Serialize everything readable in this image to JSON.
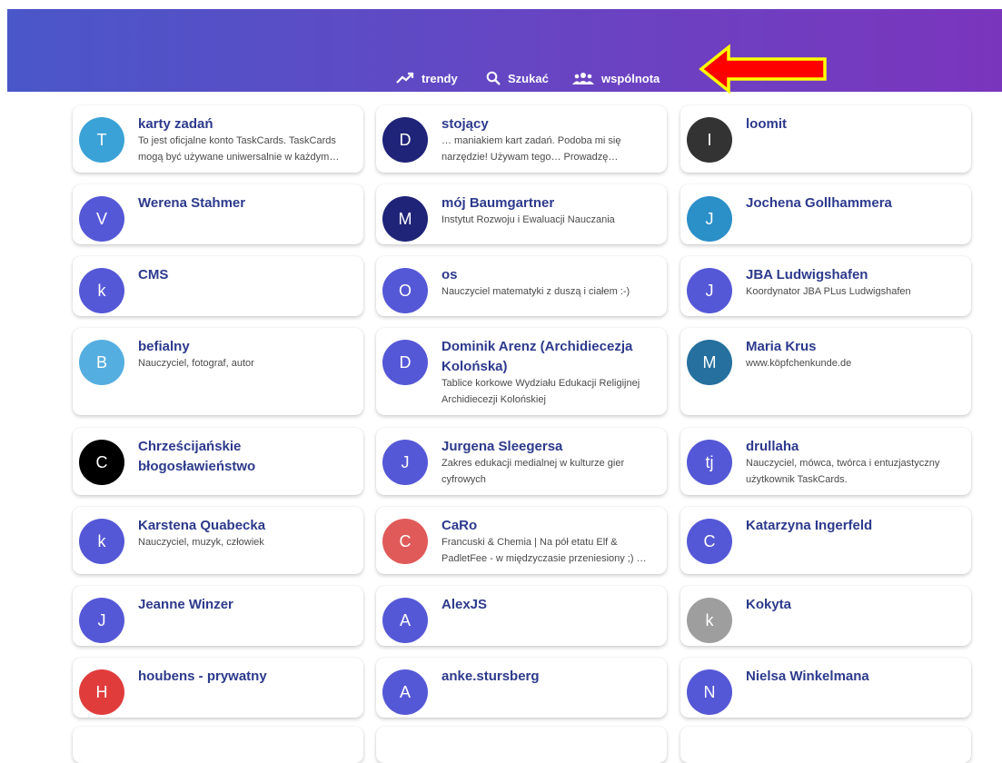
{
  "nav": {
    "trends": {
      "label": "trendy",
      "icon": "trending-up-icon"
    },
    "search": {
      "label": "Szukać",
      "icon": "search-icon"
    },
    "community": {
      "label": "wspólnota",
      "icon": "people-icon"
    }
  },
  "colors": {
    "header_from": "#4a57c9",
    "header_to": "#7a35bd",
    "arrow_fill": "#ff0000",
    "arrow_outline": "#ffff00",
    "name_text": "#2d3a8c"
  },
  "cards": [
    {
      "initial": "T",
      "avatar_color": "#3aa2d6",
      "name": "karty zadań",
      "desc": "To jest oficjalne konto TaskCards. TaskCards mogą być używane uniwersalnie w każdym…"
    },
    {
      "initial": "D",
      "avatar_color": "#1f2478",
      "name": "stojący",
      "desc": "… maniakiem kart zadań. Podoba mi się narzędzie! Używam tego… Prowadzę…"
    },
    {
      "initial": "I",
      "avatar_color": "#333333",
      "name": "loomit",
      "desc": ""
    },
    {
      "initial": "V",
      "avatar_color": "#5558d6",
      "name": "Werena Stahmer",
      "desc": ""
    },
    {
      "initial": "M",
      "avatar_color": "#1f2478",
      "name": "mój Baumgartner",
      "desc": "Instytut Rozwoju i Ewaluacji Nauczania"
    },
    {
      "initial": "J",
      "avatar_color": "#2b8fc8",
      "name": "Jochena Gollhammera",
      "desc": ""
    },
    {
      "initial": "k",
      "avatar_color": "#5558d6",
      "name": "CMS",
      "desc": ""
    },
    {
      "initial": "O",
      "avatar_color": "#5558d6",
      "name": "os",
      "desc": "Nauczyciel matematyki z duszą i ciałem :-)"
    },
    {
      "initial": "J",
      "avatar_color": "#5558d6",
      "name": "JBA Ludwigshafen",
      "desc": "Koordynator JBA PLus Ludwigshafen"
    },
    {
      "initial": "B",
      "avatar_color": "#55aee0",
      "name": "befialny",
      "desc": "Nauczyciel, fotograf, autor"
    },
    {
      "initial": "D",
      "avatar_color": "#5558d6",
      "name": "Dominik Arenz (Archidiecezja Kolońska)",
      "desc": "Tablice korkowe Wydziału Edukacji Religijnej Archidiecezji Kolońskiej"
    },
    {
      "initial": "M",
      "avatar_color": "#25709e",
      "name": "Maria Krus",
      "desc": "www.köpfchenkunde.de"
    },
    {
      "initial": "C",
      "avatar_color": "#000000",
      "name": "Chrześcijańskie błogosławieństwo",
      "desc": ""
    },
    {
      "initial": "J",
      "avatar_color": "#5558d6",
      "name": "Jurgena Sleegersa",
      "desc": "Zakres edukacji medialnej w kulturze gier cyfrowych"
    },
    {
      "initial": "tj",
      "avatar_color": "#5558d6",
      "name": "drullaha",
      "desc": "Nauczyciel, mówca, twórca i entuzjastyczny użytkownik TaskCards."
    },
    {
      "initial": "k",
      "avatar_color": "#5558d6",
      "name": "Karstena Quabecka",
      "desc": "Nauczyciel, muzyk, człowiek"
    },
    {
      "initial": "C",
      "avatar_color": "#e05a5a",
      "name": "CaRo",
      "desc": "Francuski & Chemia | Na pół etatu Elf & PadletFee - w międzyczasie przeniesiony ;) …"
    },
    {
      "initial": "C",
      "avatar_color": "#5558d6",
      "name": "Katarzyna Ingerfeld",
      "desc": ""
    },
    {
      "initial": "J",
      "avatar_color": "#5558d6",
      "name": "Jeanne Winzer",
      "desc": ""
    },
    {
      "initial": "A",
      "avatar_color": "#5558d6",
      "name": "AlexJS",
      "desc": ""
    },
    {
      "initial": "k",
      "avatar_color": "#9e9e9e",
      "name": "Kokyta",
      "desc": ""
    },
    {
      "initial": "H",
      "avatar_color": "#e03c3c",
      "name": "houbens - prywatny",
      "desc": ""
    },
    {
      "initial": "A",
      "avatar_color": "#5558d6",
      "name": "anke.stursberg",
      "desc": ""
    },
    {
      "initial": "N",
      "avatar_color": "#5558d6",
      "name": "Nielsa Winkelmana",
      "desc": ""
    },
    {
      "initial": "",
      "avatar_color": "#5558d6",
      "name": "",
      "desc": ""
    },
    {
      "initial": "",
      "avatar_color": "#5558d6",
      "name": "",
      "desc": ""
    },
    {
      "initial": "",
      "avatar_color": "#5558d6",
      "name": "",
      "desc": ""
    }
  ]
}
